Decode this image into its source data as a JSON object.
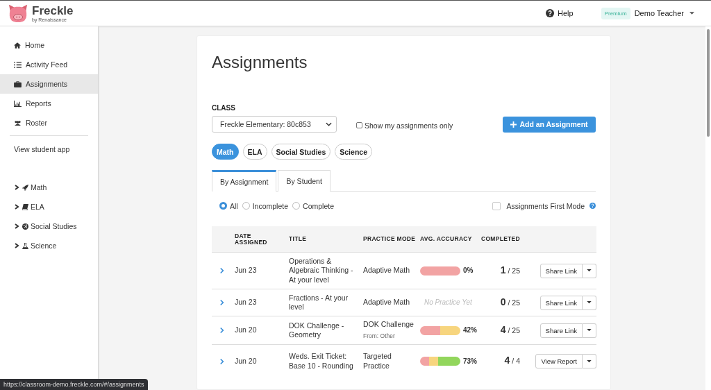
{
  "header": {
    "brand": "Freckle",
    "tagline": "by Renaissance",
    "help": "Help",
    "plan_badge": "Premium",
    "user": "Demo Teacher"
  },
  "sidebar": {
    "items": [
      {
        "label": "Home",
        "kind": "home",
        "selected": false
      },
      {
        "label": "Activity Feed",
        "kind": "list",
        "selected": false
      },
      {
        "label": "Assignments",
        "kind": "briefcase",
        "selected": true
      },
      {
        "label": "Reports",
        "kind": "chart",
        "selected": false
      },
      {
        "label": "Roster",
        "kind": "users",
        "selected": false
      }
    ],
    "link": "View student app",
    "subjects": [
      {
        "label": "Math",
        "kind": "rocket",
        "expanded": false
      },
      {
        "label": "ELA",
        "kind": "book",
        "expanded": false
      },
      {
        "label": "Social Studies",
        "kind": "globe",
        "expanded": false
      },
      {
        "label": "Science",
        "kind": "flask",
        "expanded": false
      }
    ]
  },
  "page": {
    "title": "Assignments",
    "class_label": "CLASS",
    "class_select": "Freckle Elementary: 80c853",
    "show_mine": {
      "label": "Show my assignments only",
      "checked": false
    },
    "add_button": "Add an Assignment",
    "subject_pills": [
      {
        "label": "Math",
        "selected": true
      },
      {
        "label": "ELA",
        "selected": false
      },
      {
        "label": "Social Studies",
        "selected": false
      },
      {
        "label": "Science",
        "selected": false
      }
    ],
    "tabs": [
      {
        "label": "By Assignment",
        "selected": true
      },
      {
        "label": "By Student",
        "selected": false
      }
    ],
    "filters": [
      {
        "label": "All",
        "selected": true
      },
      {
        "label": "Incomplete",
        "selected": false
      },
      {
        "label": "Complete",
        "selected": false
      }
    ],
    "first_mode": {
      "label": "Assignments First Mode",
      "checked": false
    },
    "table": {
      "columns": [
        "DATE ASSIGNED",
        "TITLE",
        "PRACTICE MODE",
        "AVG. ACCURACY",
        "COMPLETED"
      ],
      "rows": [
        {
          "date": "Jun 23",
          "title": "Operations & Algebraic Thinking - At your level",
          "mode": "Adaptive Math",
          "accuracy": {
            "segments": [
              {
                "color": "#f2a3a3",
                "level": 1
              }
            ],
            "reading": "0%"
          },
          "completed": "1",
          "total": "/ 25",
          "action": "Share Link"
        },
        {
          "date": "Jun 23",
          "title": "Fractions - At your level",
          "mode": "Adaptive Math",
          "accuracy": {
            "note": "No Practice Yet"
          },
          "completed": "0",
          "total": "/ 25",
          "action": "Share Link"
        },
        {
          "date": "Jun 20",
          "title": "DOK Challenge - Geometry",
          "mode": "DOK Challenge",
          "source": "From: Other",
          "accuracy": {
            "segments": [
              {
                "color": "#f2a3a3",
                "level": 0.5
              },
              {
                "color": "#f7d57e",
                "level": 0.5
              }
            ],
            "reading": "42%"
          },
          "completed": "4",
          "total": "/ 25",
          "action": "Share Link"
        },
        {
          "date": "Jun 20",
          "title": "Weds. Exit Ticket: Base 10 - Rounding",
          "mode": "Targeted Practice",
          "accuracy": {
            "segments": [
              {
                "color": "#f2a3a3",
                "level": 0.22
              },
              {
                "color": "#f7d57e",
                "level": 0.23
              },
              {
                "color": "#92d65c",
                "level": 0.55
              }
            ],
            "reading": "73%"
          },
          "completed": "4",
          "total": "/ 4",
          "action": "View Report"
        }
      ]
    }
  },
  "status_url": "https://classroom-demo.freckle.com/#/assignments"
}
